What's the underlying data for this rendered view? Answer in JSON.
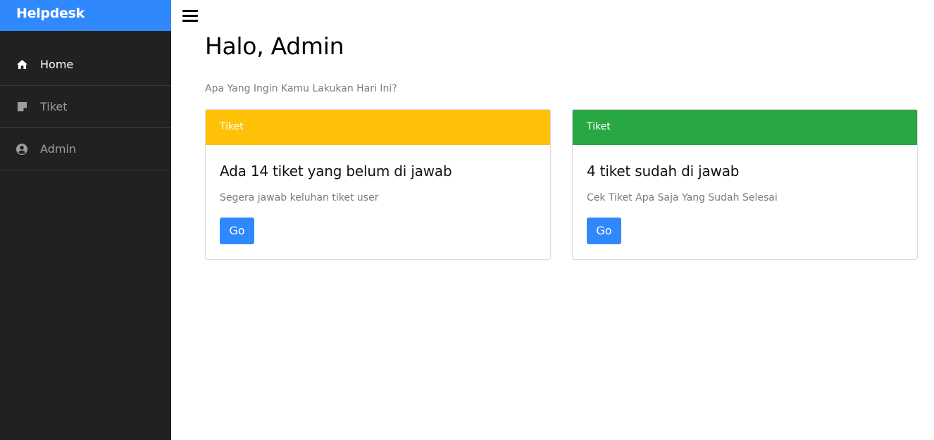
{
  "brand": "Helpdesk",
  "sidebar": {
    "items": [
      {
        "label": "Home",
        "icon": "home-icon",
        "active": true
      },
      {
        "label": "Tiket",
        "icon": "sticky-note-icon",
        "active": false
      },
      {
        "label": "Admin",
        "icon": "user-circle-icon",
        "active": false
      }
    ]
  },
  "header": {
    "menu_icon": "hamburger-icon",
    "title": "Halo, Admin",
    "subtitle": "Apa Yang Ingin Kamu Lakukan Hari Ini?"
  },
  "cards": [
    {
      "header": "Tiket",
      "header_color": "#ffc107",
      "title": "Ada 14 tiket yang belum di jawab",
      "text": "Segera jawab keluhan tiket user",
      "button": "Go"
    },
    {
      "header": "Tiket",
      "header_color": "#28a745",
      "title": "4 tiket sudah di jawab",
      "text": "Cek Tiket Apa Saja Yang Sudah Selesai",
      "button": "Go"
    }
  ],
  "colors": {
    "accent": "#2f89fc",
    "sidebar_bg": "#212121"
  }
}
